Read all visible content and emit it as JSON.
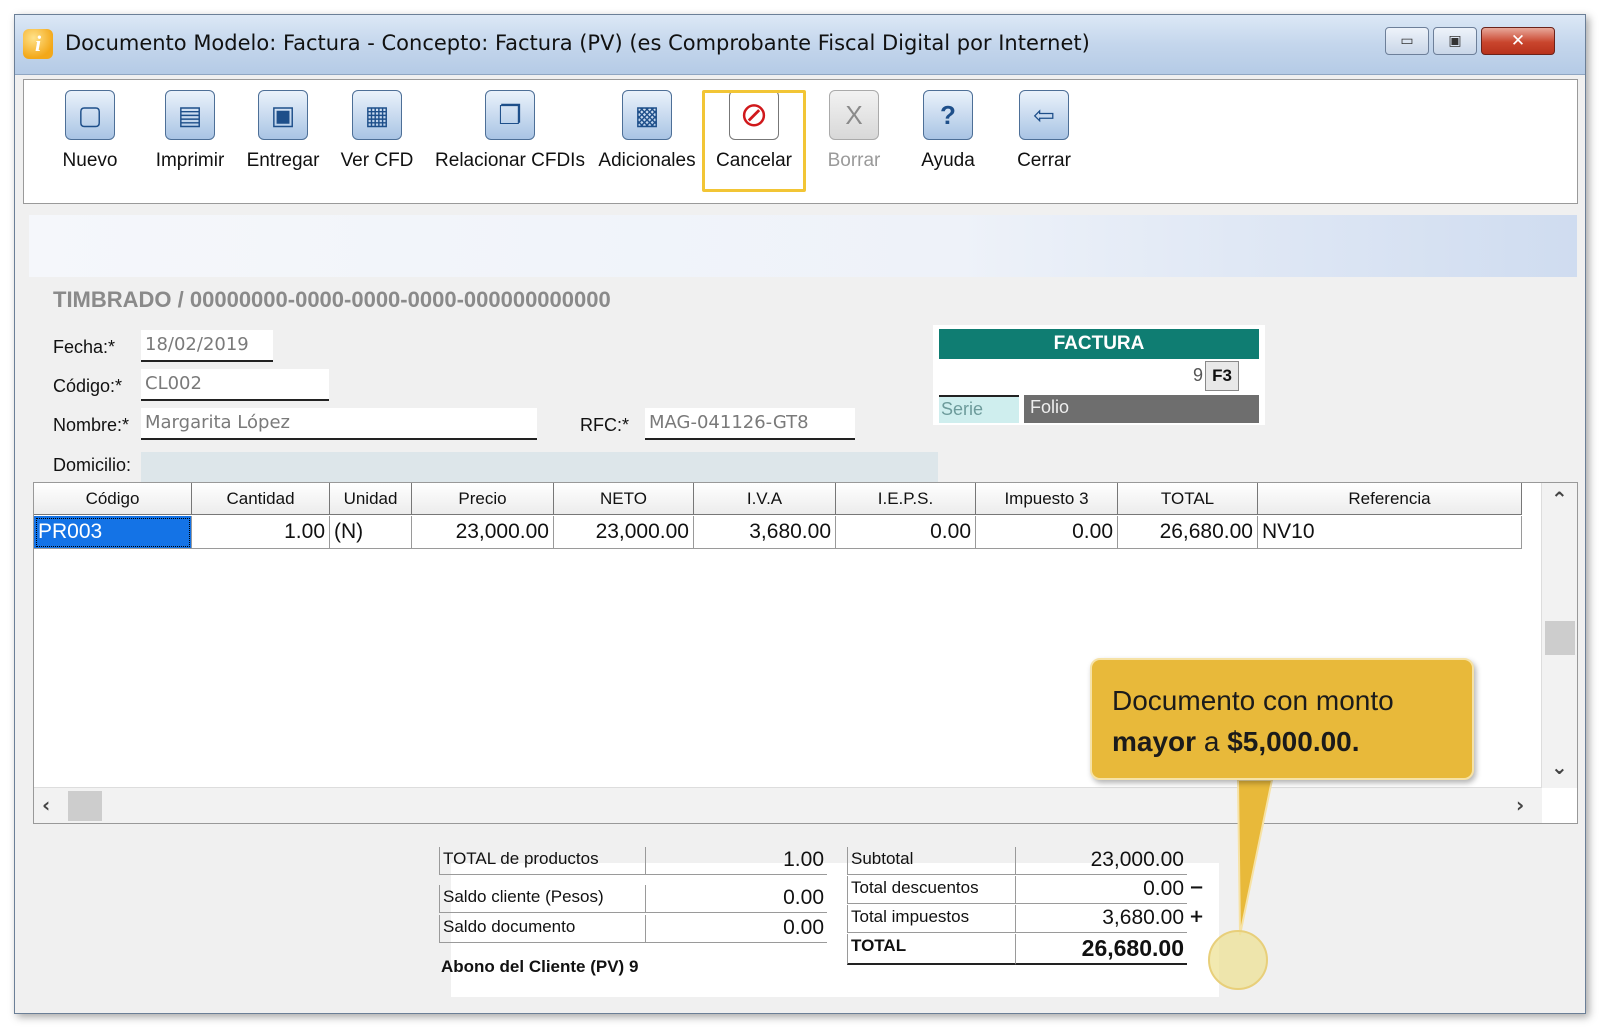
{
  "window": {
    "title": "Documento Modelo: Factura - Concepto: Factura (PV) (es Comprobante Fiscal Digital por Internet)",
    "min_glyph": "▭",
    "max_glyph": "▣",
    "close_glyph": "✕"
  },
  "toolbar": {
    "nuevo": "Nuevo",
    "imprimir": "Imprimir",
    "entregar": "Entregar",
    "ver_cfd": "Ver CFD",
    "relacionar": "Relacionar CFDIs",
    "adicionales": "Adicionales",
    "cancelar": "Cancelar",
    "borrar": "Borrar",
    "ayuda": "Ayuda",
    "cerrar": "Cerrar"
  },
  "timbrado": "TIMBRADO / 00000000-0000-0000-0000-000000000000",
  "form": {
    "fecha_label": "Fecha:*",
    "fecha_value": "18/02/2019",
    "codigo_label": "Código:*",
    "codigo_value": "CL002",
    "nombre_label": "Nombre:*",
    "nombre_value": "Margarita López",
    "rfc_label": "RFC:*",
    "rfc_value": "MAG-041126-GT8",
    "domicilio_label": "Domicilio:"
  },
  "factura": {
    "header": "FACTURA",
    "folio_number": "9",
    "f3": "F3",
    "serie_label": "Serie",
    "folio_label": "Folio"
  },
  "grid": {
    "columns": [
      "Código",
      "Cantidad",
      "Unidad",
      "Precio",
      "NETO",
      "I.V.A",
      "I.E.P.S.",
      "Impuesto 3",
      "TOTAL",
      "Referencia"
    ],
    "rows": [
      {
        "codigo": "PR003",
        "cantidad": "1.00",
        "unidad": "(N)",
        "precio": "23,000.00",
        "neto": "23,000.00",
        "iva": "3,680.00",
        "ieps": "0.00",
        "impuesto3": "0.00",
        "total": "26,680.00",
        "referencia": "NV10"
      }
    ]
  },
  "callout": {
    "line1": "Documento con monto",
    "bold1": "mayor",
    "mid": " a ",
    "bold2": "$5,000.00."
  },
  "totals": {
    "total_productos_label": "TOTAL de productos",
    "total_productos_value": "1.00",
    "saldo_cliente_label": "Saldo cliente (Pesos)",
    "saldo_cliente_value": "0.00",
    "saldo_documento_label": "Saldo documento",
    "saldo_documento_value": "0.00",
    "subtotal_label": "Subtotal",
    "subtotal_value": "23,000.00",
    "descuentos_label": "Total descuentos",
    "descuentos_value": "0.00",
    "impuestos_label": "Total impuestos",
    "impuestos_value": "3,680.00",
    "total_label": "TOTAL",
    "total_value": "26,680.00",
    "minus": "−",
    "plus": "+",
    "abono": "Abono del Cliente  (PV)  9"
  },
  "icons": {
    "nuevo": "new-doc-icon",
    "imprimir": "printer-icon",
    "entregar": "deliver-icon",
    "ver_cfd": "view-cfd-icon",
    "relacionar": "relate-cfdi-icon",
    "adicionales": "additional-icon",
    "cancelar": "cancel-icon",
    "borrar": "delete-icon",
    "ayuda": "help-icon",
    "cerrar": "exit-icon"
  },
  "colors": {
    "factura_header": "#0f7d72",
    "callout": "#e8b93a",
    "highlight": "#f2c535",
    "selection": "#1473e6"
  }
}
